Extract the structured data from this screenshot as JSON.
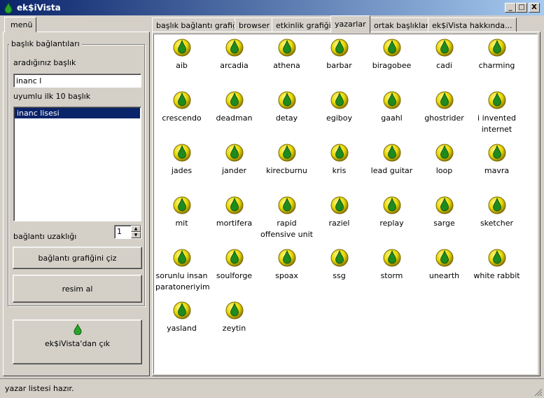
{
  "window": {
    "title": "ek$iVista",
    "min": "_",
    "max": "□",
    "close": "X"
  },
  "left_tab": {
    "label": "menü"
  },
  "group": {
    "legend": "başlık bağlantıları",
    "search_label": "aradığınız başlık",
    "search_value": "inanc l",
    "list_label": "uyumlu ilk 10 başlık",
    "list_items": [
      "inanc lisesi"
    ],
    "distance_label": "bağlantı uzaklığı",
    "distance_value": "1",
    "draw_button": "bağlantı grafiğini çiz",
    "capture_button": "resim al"
  },
  "exit_button": "ek$iVista'dan çık",
  "tabs": [
    {
      "label": "başlık bağlantı grafiği",
      "active": false
    },
    {
      "label": "browser",
      "active": false
    },
    {
      "label": "etkinlik grafiği",
      "active": false
    },
    {
      "label": "yazarlar",
      "active": true
    },
    {
      "label": "ortak başlıklar",
      "active": false
    },
    {
      "label": "ek$iVista hakkında...",
      "active": false
    }
  ],
  "authors": [
    "aib",
    "arcadia",
    "athena",
    "barbar",
    "biragobee",
    "cadi",
    "charming",
    "crescendo",
    "deadman",
    "detay",
    "egiboy",
    "gaahl",
    "ghostrider",
    "i invented internet",
    "jades",
    "jander",
    "kirecburnu",
    "kris",
    "lead guitar",
    "loop",
    "mavra",
    "mit",
    "mortifera",
    "rapid offensive unit",
    "raziel",
    "replay",
    "sarge",
    "sketcher",
    "sorunlu insan paratoneriyim",
    "soulforge",
    "spoax",
    "ssg",
    "storm",
    "unearth",
    "white rabbit",
    "yasland",
    "zeytin"
  ],
  "status": "yazar listesi hazır.",
  "colors": {
    "titlebar_start": "#0a246a",
    "titlebar_end": "#a6caf0",
    "selection": "#0a246a",
    "icon_circle": "#e8d800",
    "icon_drop": "#1f8a1f"
  },
  "icons": {
    "author_icon": "yellow-circle-green-drop-icon",
    "app_icon": "green-drop-icon"
  }
}
